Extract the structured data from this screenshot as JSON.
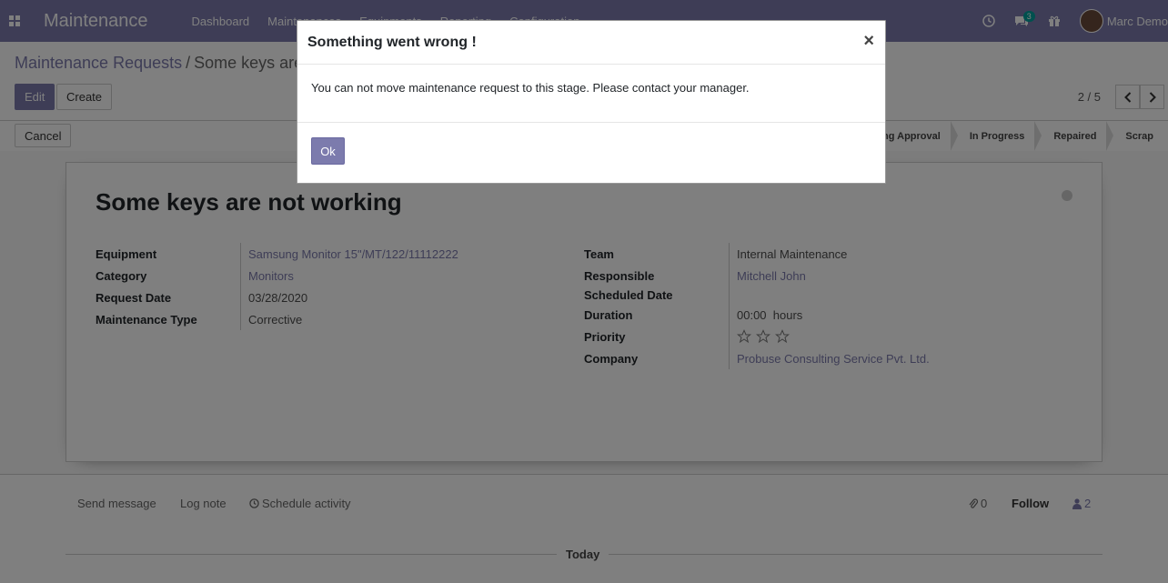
{
  "navbar": {
    "brand": "Maintenance",
    "menu": [
      "Dashboard",
      "Maintenances",
      "Equipments",
      "Reporting",
      "Configuration"
    ],
    "messages_badge": "3",
    "user_name": "Marc Demo"
  },
  "control": {
    "breadcrumb_parent": "Maintenance Requests",
    "breadcrumb_separator": "/",
    "breadcrumb_current": "Some keys are not working",
    "edit_label": "Edit",
    "create_label": "Create",
    "cancel_label": "Cancel",
    "pager": "2 / 5"
  },
  "stages": [
    "Pending Approval",
    "In Progress",
    "Repaired",
    "Scrap"
  ],
  "record": {
    "title": "Some keys are not working",
    "left_fields": [
      {
        "label": "Equipment",
        "value": "Samsung Monitor 15\"/MT/122/11112222"
      },
      {
        "label": "Category",
        "value": "Monitors"
      },
      {
        "label": "Request Date",
        "value": "03/28/2020"
      },
      {
        "label": "Maintenance Type",
        "value": "Corrective"
      }
    ],
    "right_fields": [
      {
        "label": "Team",
        "value": "Internal Maintenance"
      },
      {
        "label": "Responsible",
        "value": "Mitchell John"
      },
      {
        "label": "Scheduled Date",
        "value": ""
      },
      {
        "label": "Duration",
        "value": "00:00  hours"
      },
      {
        "label": "Priority",
        "value": ""
      },
      {
        "label": "Company",
        "value": "Probuse Consulting Service Pvt. Ltd."
      }
    ],
    "priority_stars": 0
  },
  "chatter": {
    "send_message": "Send message",
    "log_note": "Log note",
    "schedule_activity": "Schedule activity",
    "attachments": "0",
    "follow": "Follow",
    "followers": "2",
    "today": "Today"
  },
  "modal": {
    "title": "Something went wrong !",
    "close": "×",
    "message": "You can not move maintenance request to this stage. Please contact your manager.",
    "ok_label": "Ok"
  },
  "colors": {
    "brand": "#7c7bad",
    "badge": "#00a09d"
  }
}
